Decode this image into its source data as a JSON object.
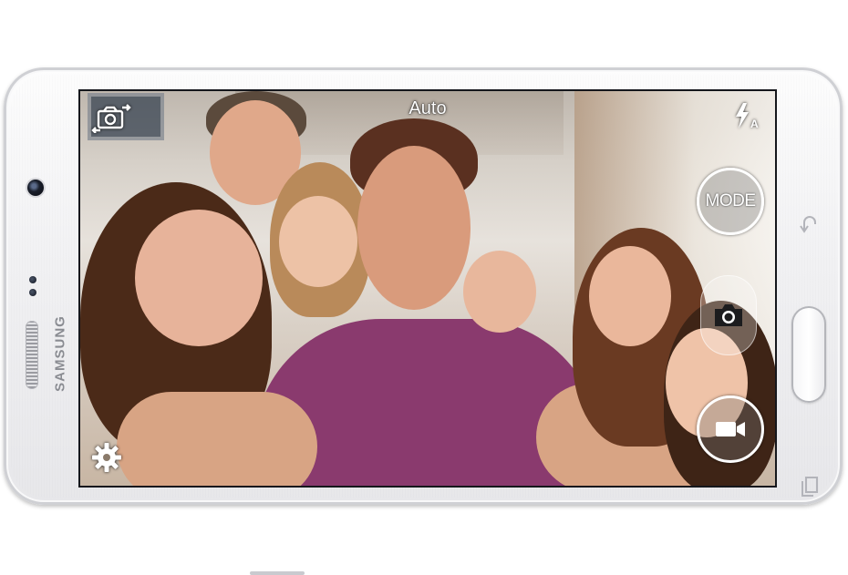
{
  "device": {
    "brand": "SAMSUNG"
  },
  "camera": {
    "mode_label": "Auto",
    "mode_button_label": "MODE",
    "icons": {
      "switch_camera": "switch-camera-icon",
      "flash": "flash-auto-icon",
      "settings": "gear-icon",
      "shutter": "camera-icon",
      "record": "video-camera-icon"
    },
    "colors": {
      "ui_foreground": "#ffffff",
      "button_fill": "rgba(120,120,120,0.35)",
      "shirt": "#8a3a6e"
    }
  }
}
